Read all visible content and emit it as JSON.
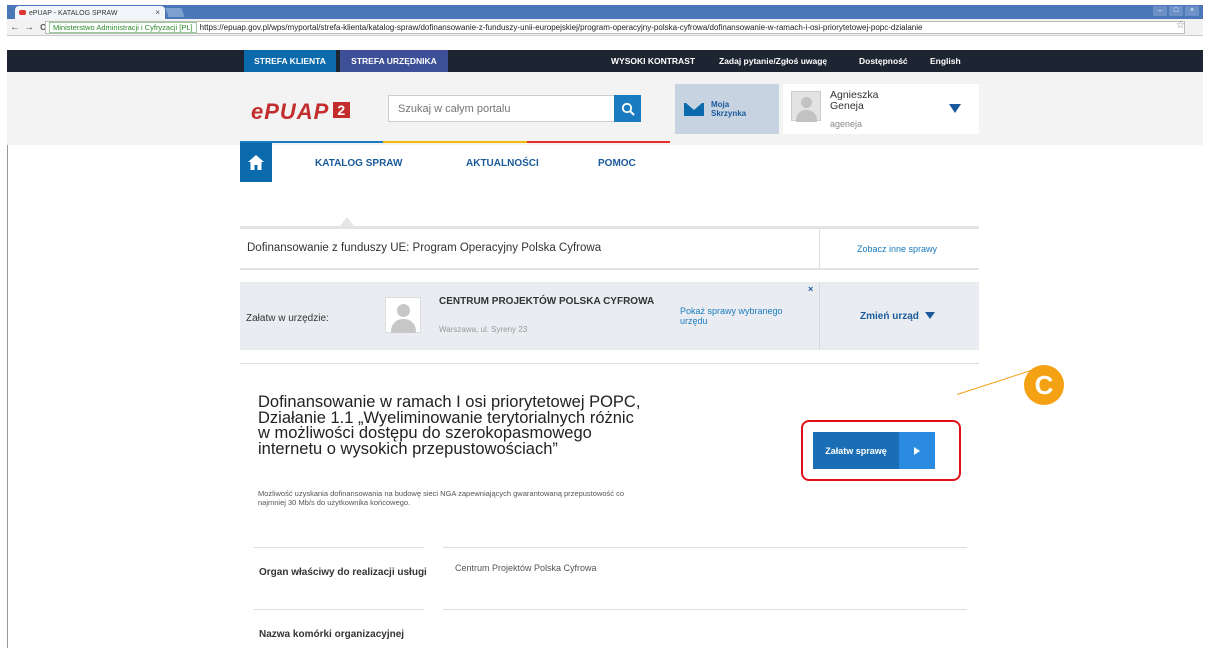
{
  "browser": {
    "tab_title": "ePUAP - KATALOG SPRAW",
    "tab_close": "×",
    "nav_back": "←",
    "nav_forward": "→",
    "nav_reload": "C",
    "secure_label": "Ministerstwo Administracji i Cyfryzacji [PL]",
    "url": "https://epuap.gov.pl/wps/myportal/strefa-klienta/katalog-spraw/dofinansowanie-z-funduszy-unii-europejskiej/program-operacyjny-polska-cyfrowa/dofinansowanie-w-ramach-i-osi-priorytetowej-popc-dzialanie",
    "star": "☆"
  },
  "topbar": {
    "client_zone": "STREFA KLIENTA",
    "official_zone": "STREFA URZĘDNIKA",
    "high_contrast": "WYSOKI KONTRAST",
    "ask_question": "Zadaj pytanie/Zgłoś uwagę",
    "accessibility": "Dostępność",
    "english": "English"
  },
  "header": {
    "logo_text": "ePUAP",
    "logo_badge": "2",
    "search_placeholder": "Szukaj w całym portalu",
    "mailbox_label": "Moja\nSkrzynka",
    "user_name": "Agnieszka\nGeneja",
    "user_login": "ageneja"
  },
  "nav": {
    "items": [
      "KATALOG SPRAW",
      "AKTUALNOŚCI",
      "POMOC"
    ],
    "colors": [
      "#1a7bc0",
      "#f2b807",
      "#e5312a"
    ]
  },
  "service": {
    "category_title": "Dofinansowanie z funduszy UE: Program Operacyjny Polska Cyfrowa",
    "see_other": "Zobacz inne sprawy",
    "office_label": "Załatw w urzędzie:",
    "office_name": "CENTRUM PROJEKTÓW POLSKA CYFROWA",
    "office_address": "Warszawa, ul. Syreny 23",
    "show_services": "Pokaż sprawy wybranego urzędu",
    "clear": "×",
    "change_office": "Zmień urząd",
    "title": "Dofinansowanie w ramach I osi priorytetowej POPC, Działanie 1.1 „Wyeliminowanie terytorialnych różnic w możliwości dostępu do szerokopasmowego internetu o wysokich przepustowościach”",
    "description": "Możliwość uzyskania dofinansowania na budowę sieci NGA zapewniających gwarantowaną przepustowość co najmniej 30 Mb/s do użytkownika końcowego.",
    "action_button": "Załatw sprawę",
    "callout": "C"
  },
  "details": {
    "rows": [
      {
        "label": "Organ właściwy do realizacji usługi",
        "value": "Centrum Projektów Polska Cyfrowa"
      },
      {
        "label": "Nazwa komórki organizacyjnej",
        "value": ""
      }
    ]
  },
  "colors": {
    "brand_blue": "#0b6aab",
    "official_zone": "#3d4f96",
    "highlight": "#e0101a",
    "callout": "#f5a114"
  }
}
